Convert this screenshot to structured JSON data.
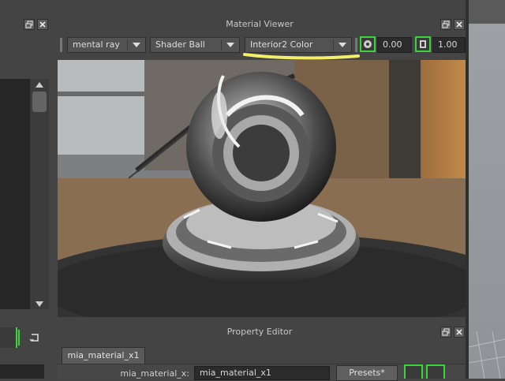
{
  "material_viewer": {
    "title": "Material Viewer",
    "renderer": "mental ray",
    "geometry": "Shader Ball",
    "environment": "Interior2 Color",
    "exposure_value": "0.00",
    "gamma_value": "1.00"
  },
  "property_editor": {
    "title": "Property Editor",
    "tab_label": "mia_material_x1",
    "field_label": "mia_material_x:",
    "field_value": "mia_material_x1",
    "presets_label": "Presets*"
  },
  "icons": {
    "float": "float-window-icon",
    "close": "close-icon",
    "exposure": "exposure-icon",
    "gamma": "gamma-icon"
  },
  "colors": {
    "highlight_underline": "#f3ee6a",
    "bracket_green": "#39d639"
  }
}
